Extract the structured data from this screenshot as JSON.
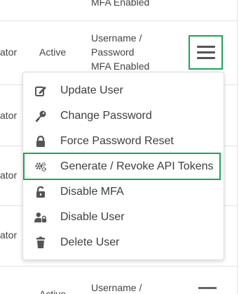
{
  "top_row": {
    "auth": "MFA Enabled"
  },
  "row1": {
    "role": "ator",
    "status": "Active",
    "auth_line1": "Username /",
    "auth_line2": "Password",
    "auth_line3": "MFA Enabled"
  },
  "row2": {
    "role": "ator"
  },
  "row3": {
    "role": "ator"
  },
  "row4": {
    "role": "ator"
  },
  "bottom_row": {
    "status": "Active",
    "auth_line1": "Username /"
  },
  "menu": {
    "items": [
      {
        "label": "Update User",
        "icon": "edit-icon"
      },
      {
        "label": "Change Password",
        "icon": "key-icon"
      },
      {
        "label": "Force Password Reset",
        "icon": "lock-icon"
      },
      {
        "label": "Generate / Revoke API Tokens",
        "icon": "gears-icon"
      },
      {
        "label": "Disable MFA",
        "icon": "unlock-icon"
      },
      {
        "label": "Disable User",
        "icon": "user-lock-icon"
      },
      {
        "label": "Delete User",
        "icon": "trash-icon"
      }
    ]
  },
  "colors": {
    "highlight": "#21a35a",
    "icon": "#555555"
  }
}
